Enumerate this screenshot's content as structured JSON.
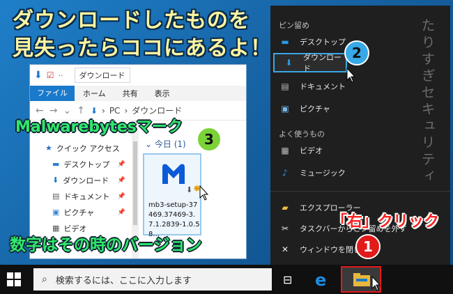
{
  "annotations": {
    "title": "ダウンロードしたものを\n見失ったらココにあるよ！",
    "malwarebytes": "Malwarebytesマーク",
    "version": "数字はその時のバージョン",
    "right_click": "「右」クリック",
    "vertical_text": "たりすぎセキュリティ",
    "badges": [
      "1",
      "2",
      "3"
    ]
  },
  "explorer": {
    "tab_title": "ダウンロード",
    "ribbon_tabs": [
      "ファイル",
      "ホーム",
      "共有",
      "表示"
    ],
    "path": [
      "PC",
      "ダウンロード"
    ],
    "nav_items": [
      {
        "label": "クイック アクセス",
        "icon": "star-icon"
      },
      {
        "label": "デスクトップ",
        "icon": "desktop-icon"
      },
      {
        "label": "ダウンロード",
        "icon": "download-icon"
      },
      {
        "label": "ドキュメント",
        "icon": "document-icon"
      },
      {
        "label": "ピクチャ",
        "icon": "picture-icon"
      },
      {
        "label": "ビデオ",
        "icon": "video-icon"
      }
    ],
    "group_header": "今日 (1)",
    "file_name": "mb3-setup-37469.37469-3.7.1.2839-1.0.58..."
  },
  "jump_list": {
    "pinned_header": "ピン留め",
    "pinned": [
      {
        "label": "デスクトップ",
        "icon": "desktop-icon"
      },
      {
        "label": "ダウンロード",
        "icon": "download-icon"
      },
      {
        "label": "ドキュメント",
        "icon": "document-icon"
      },
      {
        "label": "ピクチャ",
        "icon": "picture-icon"
      }
    ],
    "frequent_header": "よく使うもの",
    "frequent": [
      {
        "label": "ビデオ",
        "icon": "video-icon"
      },
      {
        "label": "ミュージック",
        "icon": "music-icon"
      }
    ],
    "actions": [
      {
        "label": "エクスプローラー",
        "icon": "folder-icon"
      },
      {
        "label": "タスクバーからピン留めを外す",
        "icon": "unpin-icon"
      },
      {
        "label": "ウィンドウを閉じる",
        "icon": "close-icon"
      }
    ]
  },
  "taskbar": {
    "search_placeholder": "検索するには、ここに入力します"
  },
  "colors": {
    "accent_blue": "#1979ca",
    "annotation_green": "#2fe86c",
    "annotation_yellow": "#fff5a0",
    "highlight_red": "#e21a1a",
    "jump_bg": "#1f1f1f"
  }
}
